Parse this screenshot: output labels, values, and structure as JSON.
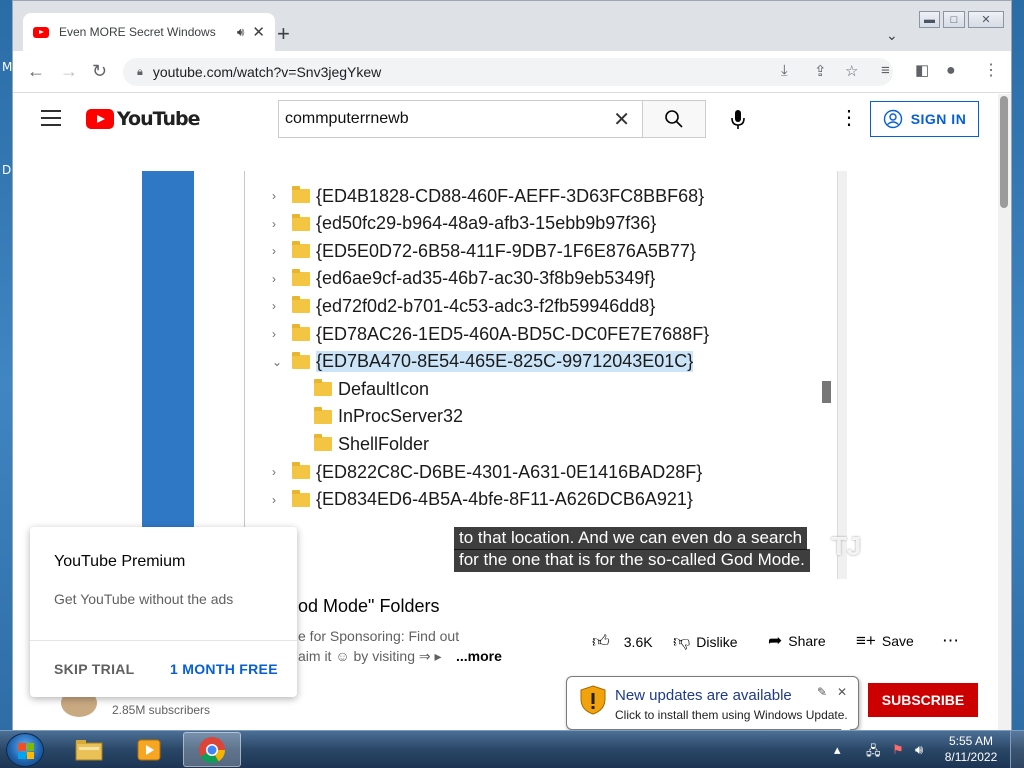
{
  "browser": {
    "tab_title": "Even MORE Secret Windows",
    "tab_audio_icon": "speaker-icon",
    "tab_close": "✕",
    "new_tab": "+",
    "tab_search": "⌄",
    "url": "youtube.com/watch?v=Snv3jegYkew"
  },
  "youtube": {
    "logo_text": "YouTube",
    "search_value": "commputerrnewb",
    "sign_in": "SIGN IN"
  },
  "video": {
    "registry_rows": [
      {
        "text": "{ED4B1828-CD88-460F-AEFF-3D63FC8BBF68}",
        "depth": 0,
        "expanded": false,
        "selected": false
      },
      {
        "text": "{ed50fc29-b964-48a9-afb3-15ebb9b97f36}",
        "depth": 0,
        "expanded": false,
        "selected": false
      },
      {
        "text": "{ED5E0D72-6B58-411F-9DB7-1F6E876A5B77}",
        "depth": 0,
        "expanded": false,
        "selected": false
      },
      {
        "text": "{ed6ae9cf-ad35-46b7-ac30-3f8b9eb5349f}",
        "depth": 0,
        "expanded": false,
        "selected": false
      },
      {
        "text": "{ed72f0d2-b701-4c53-adc3-f2fb59946dd8}",
        "depth": 0,
        "expanded": false,
        "selected": false
      },
      {
        "text": "{ED78AC26-1ED5-460A-BD5C-DC0FE7E7688F}",
        "depth": 0,
        "expanded": false,
        "selected": false
      },
      {
        "text": "{ED7BA470-8E54-465E-825C-99712043E01C}",
        "depth": 0,
        "expanded": true,
        "selected": true
      },
      {
        "text": "DefaultIcon",
        "depth": 1,
        "expanded": false,
        "selected": false
      },
      {
        "text": "InProcServer32",
        "depth": 1,
        "expanded": false,
        "selected": false
      },
      {
        "text": "ShellFolder",
        "depth": 1,
        "expanded": false,
        "selected": false
      },
      {
        "text": "{ED822C8C-D6BE-4301-A631-0E1416BAD28F}",
        "depth": 0,
        "expanded": false,
        "selected": false
      },
      {
        "text": "{ED834ED6-4B5A-4bfe-8F11-A626DCB6A921}",
        "depth": 0,
        "expanded": false,
        "selected": false
      }
    ],
    "captions": [
      "to that location. And we can even do a search",
      "for the one that is for the so-called God Mode."
    ],
    "title": "od Mode\" Folders",
    "desc_line1": "e for Sponsoring: Find out",
    "desc_line2": "aim it ☺ by visiting ⇒ ▸",
    "more": "...more",
    "likes": "3.6K",
    "dislike": "Dislike",
    "share": "Share",
    "save": "Save",
    "subscribers": "2.85M subscribers",
    "subscribe": "SUBSCRIBE"
  },
  "premium_popup": {
    "title": "YouTube Premium",
    "subtitle": "Get YouTube without the ads",
    "skip": "SKIP TRIAL",
    "cta": "1 MONTH FREE"
  },
  "notification": {
    "title": "New updates are available",
    "subtitle": "Click to install them using Windows Update."
  },
  "taskbar": {
    "time": "5:55 AM",
    "date": "8/11/2022"
  },
  "colors": {
    "youtube_red": "#ff0000",
    "link_blue": "#065fd4",
    "subscribe_red": "#cc0000"
  }
}
